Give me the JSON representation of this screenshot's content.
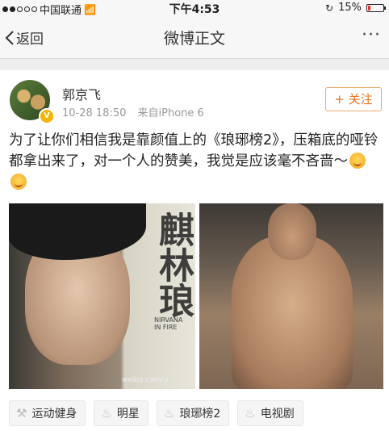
{
  "status_bar": {
    "carrier": "中国联通",
    "time": "下午4:53",
    "battery": "15%",
    "battery_level": 0.15
  },
  "nav": {
    "back_label": "返回",
    "title": "微博正文",
    "more_label": "···"
  },
  "post": {
    "author": "郭京飞",
    "date": "10-28 18:50",
    "source": "来自iPhone 6",
    "follow_label": "+ 关注",
    "text": "为了让你们相信我是靠颜值上的《琅琊榜2》，压箱底的哑铃都拿出来了，对一个人的赞美，我觉是应该毫不吝啬～",
    "image_caption_vertical": "麒林琅",
    "image_small_text": "NIRVANA IN FIRE",
    "image_watermark": "weibo.com/u"
  },
  "tags": [
    {
      "label": "运动健身",
      "icon": "run-icon"
    },
    {
      "label": "明星",
      "icon": "fire-icon"
    },
    {
      "label": "琅琊榜2",
      "icon": "fire-icon"
    },
    {
      "label": "电视剧",
      "icon": "fire-icon"
    }
  ],
  "colors": {
    "accent": "#e8731e",
    "verified": "#f4b400"
  }
}
